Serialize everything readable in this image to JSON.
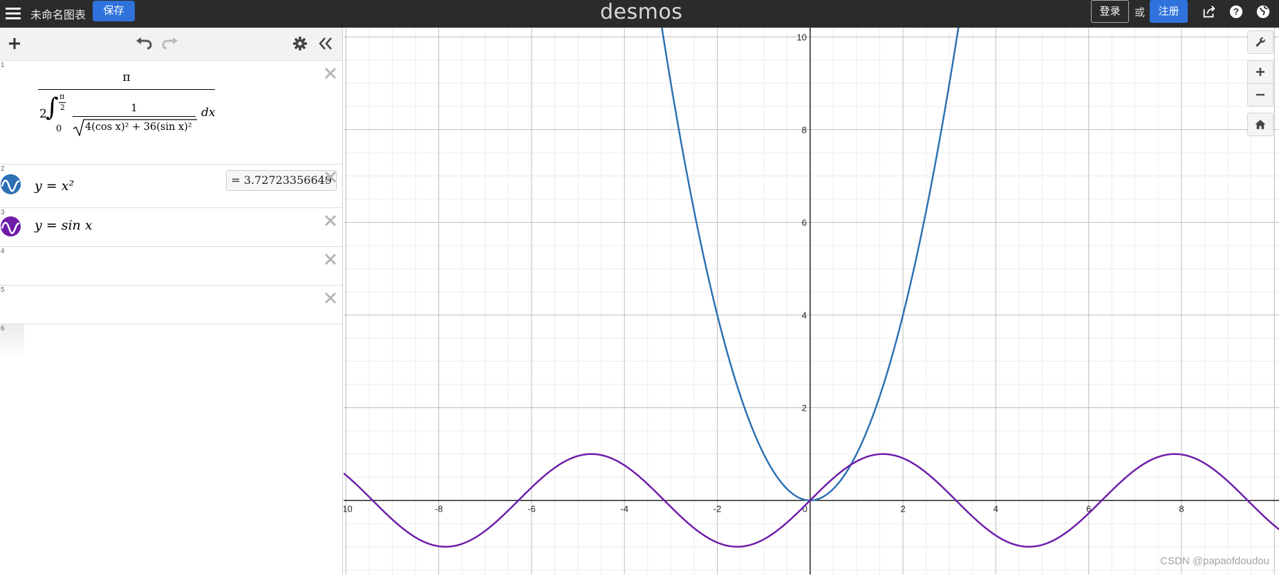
{
  "topbar": {
    "doc_title": "未命名图表",
    "save_label": "保存",
    "brand": "desmos",
    "login_label": "登录",
    "or_label": "或",
    "signup_label": "注册"
  },
  "expressions": [
    {
      "num": "1",
      "type": "integral",
      "numerator": "π",
      "coef": "2",
      "upper_num": "π",
      "upper_den": "2",
      "lower": "0",
      "inner_num": "1",
      "sqrt_body": "4(cos x)² + 36(sin x)²",
      "dx": "dx",
      "result": "=  3.72723356649"
    },
    {
      "num": "2",
      "expr": "y = x²",
      "color": "#2d70b3"
    },
    {
      "num": "3",
      "expr": "y = sin x",
      "color": "#6f1ca9"
    },
    {
      "num": "4",
      "expr": ""
    },
    {
      "num": "5",
      "expr": ""
    },
    {
      "num": "6",
      "expr": ""
    }
  ],
  "chart_data": {
    "type": "line",
    "x_range": [
      -10.05,
      10.1
    ],
    "y_range": [
      -1.6,
      10.2
    ],
    "x_ticks": [
      "-10",
      "-8",
      "-6",
      "-4",
      "-2",
      "0",
      "2",
      "4",
      "6",
      "8"
    ],
    "y_ticks": [
      "2",
      "4",
      "6",
      "8",
      "10"
    ],
    "grid": true,
    "series": [
      {
        "name": "y = x²",
        "color": "#2d70b3",
        "function": "x^2"
      },
      {
        "name": "y = sin x",
        "color": "#6f1ca9",
        "function": "sin(x)"
      }
    ]
  },
  "watermark": "CSDN @papaofdoudou"
}
